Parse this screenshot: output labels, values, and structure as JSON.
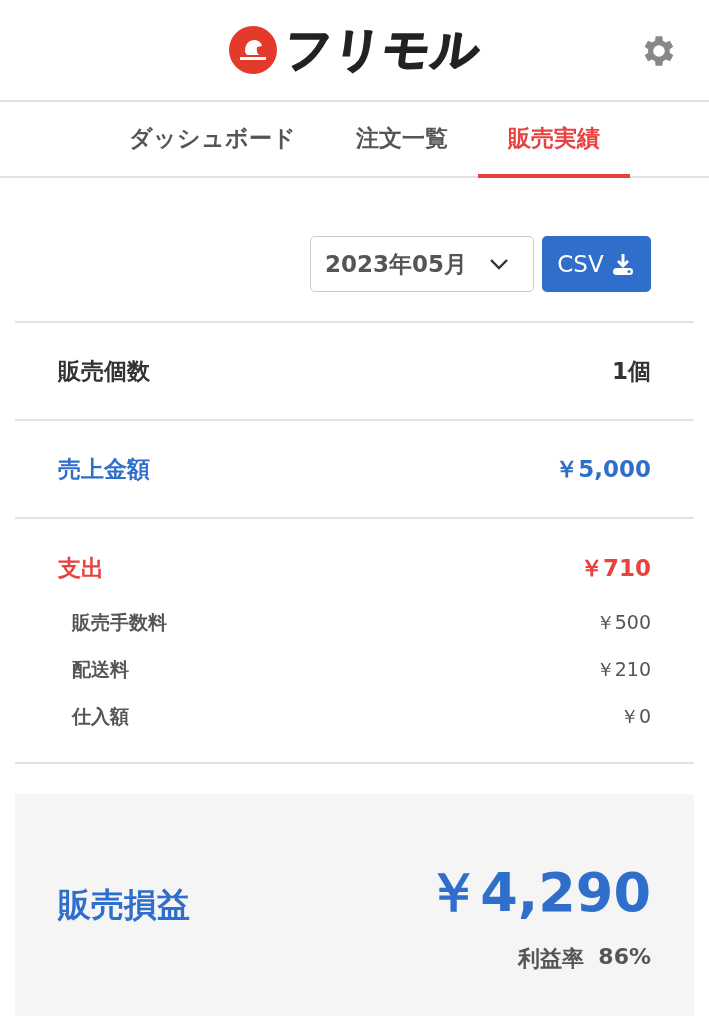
{
  "header": {
    "logo_text": "フリモル"
  },
  "tabs": [
    {
      "label": "ダッシュボード",
      "selected": false
    },
    {
      "label": "注文一覧",
      "selected": false
    },
    {
      "label": "販売実績",
      "selected": true
    }
  ],
  "filter": {
    "month": "2023年05月",
    "csv_button": "CSV"
  },
  "summary": [
    {
      "kind": "plain",
      "label": "販売個数",
      "value": "1個"
    },
    {
      "kind": "income",
      "label": "売上金額",
      "value": "￥5,000"
    },
    {
      "kind": "expense",
      "label": "支出",
      "value": "￥710",
      "children": [
        {
          "label": "販売手数料",
          "value": "￥500"
        },
        {
          "label": "配送料",
          "value": "￥210"
        },
        {
          "label": "仕入額",
          "value": "￥0"
        }
      ]
    }
  ],
  "profit": {
    "label": "販売損益",
    "value": "￥4,290",
    "rate_label": "利益率",
    "rate": "86%"
  }
}
